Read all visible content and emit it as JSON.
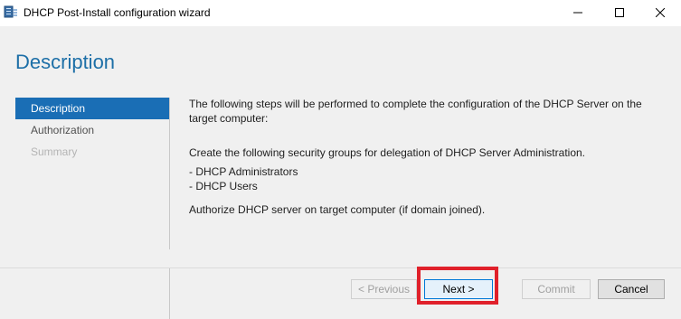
{
  "window": {
    "title": "DHCP Post-Install configuration wizard"
  },
  "header": {
    "title": "Description"
  },
  "nav": {
    "items": [
      {
        "label": "Description",
        "state": "active"
      },
      {
        "label": "Authorization",
        "state": "normal"
      },
      {
        "label": "Summary",
        "state": "disabled"
      }
    ]
  },
  "content": {
    "intro": "The following steps will be performed to complete the configuration of the DHCP Server on the target computer:",
    "groups_heading": "Create the following security groups for delegation of DHCP Server Administration.",
    "groups": [
      "- DHCP Administrators",
      "- DHCP Users"
    ],
    "authorize": "Authorize DHCP server on target computer (if domain joined)."
  },
  "footer": {
    "previous_label": "< Previous",
    "next_label": "Next >",
    "commit_label": "Commit",
    "cancel_label": "Cancel"
  },
  "colors": {
    "accent": "#1a6eb5",
    "title_blue": "#1d6fa7",
    "highlight": "#e0202a"
  },
  "icons": {
    "app": "dhcp-server-icon",
    "minimize": "minimize-icon",
    "maximize": "maximize-icon",
    "close": "close-icon"
  }
}
